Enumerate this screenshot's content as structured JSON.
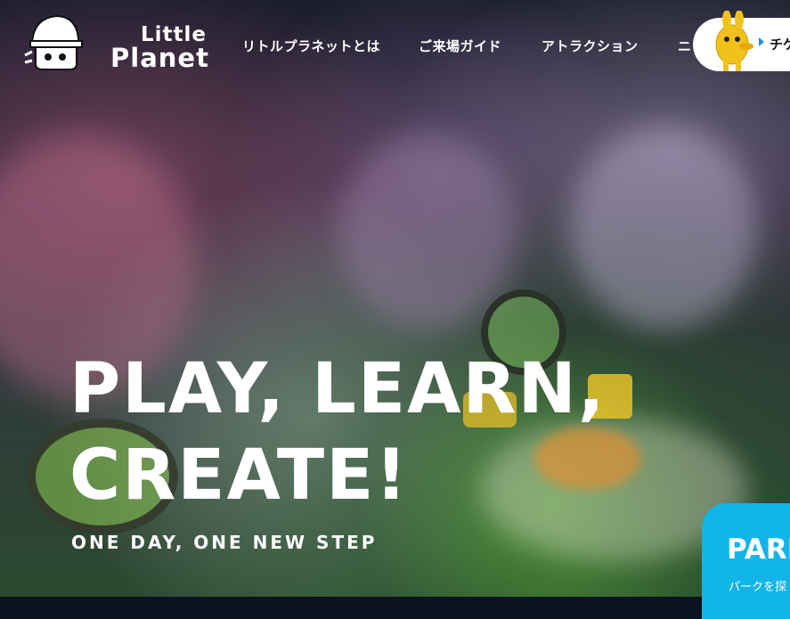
{
  "brand": {
    "logo_line1": "Little",
    "logo_line2": "Planet"
  },
  "nav": {
    "items": [
      {
        "label": "リトルプラネットとは"
      },
      {
        "label": "ご来場ガイド"
      },
      {
        "label": "アトラクション"
      },
      {
        "label": "ニ"
      }
    ],
    "ticket_label": "チケ"
  },
  "hero": {
    "headline_line1": "PLAY, LEARN,",
    "headline_line2": "CREATE!",
    "tagline": "ONE DAY, ONE NEW STEP"
  },
  "park_card": {
    "title": "PARK",
    "subtitle": "パークを探"
  },
  "colors": {
    "accent_blue": "#12b5e8",
    "ticket_arrow": "#1a8cff",
    "mascot_yellow": "#f2c21c"
  },
  "icons": {
    "logo_mascot": "hard-hat-mascot-icon",
    "ticket_mascot": "yellow-character-icon",
    "ticket_arrow": "play-arrow-icon"
  }
}
